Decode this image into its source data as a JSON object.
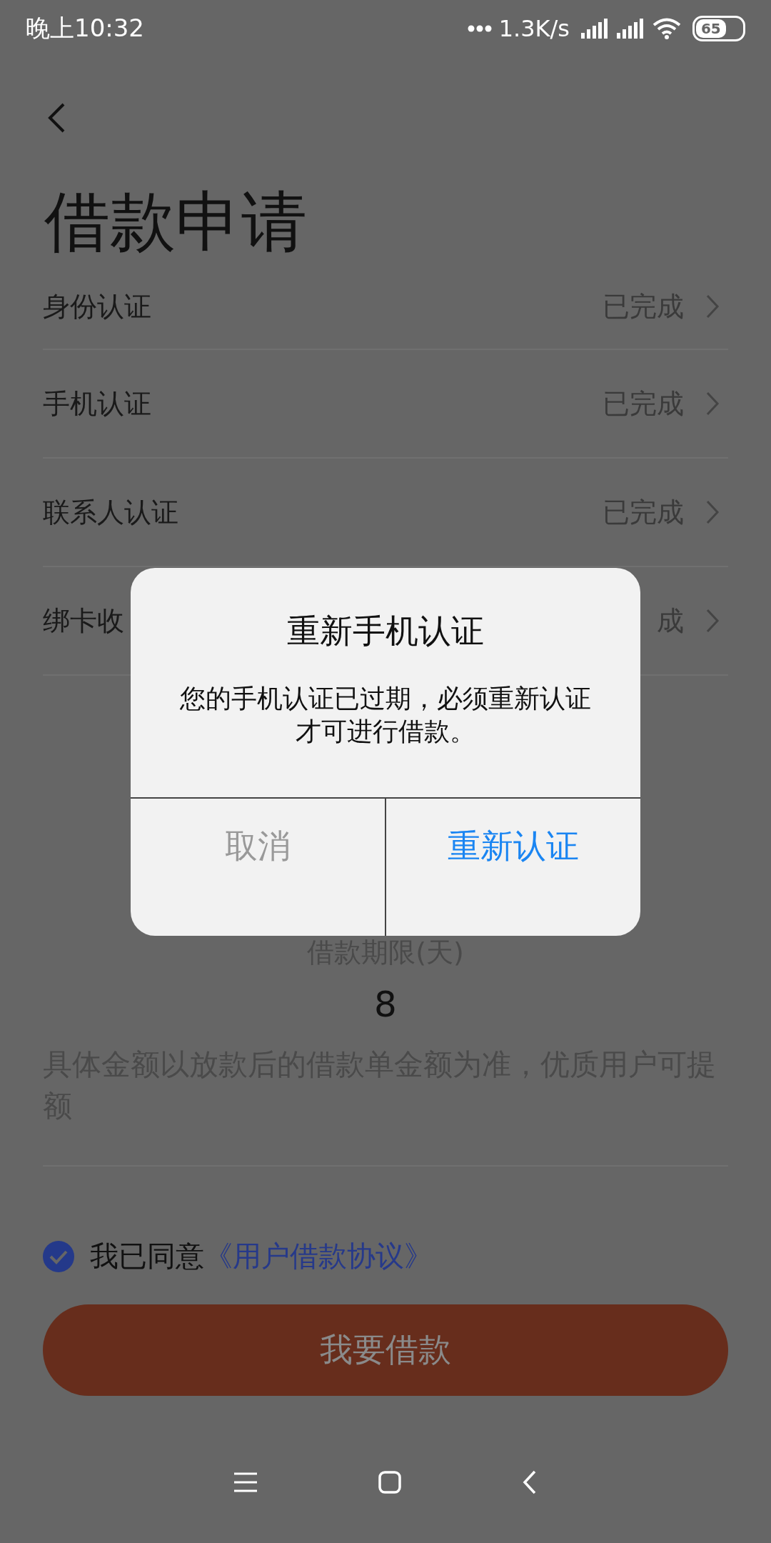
{
  "status_bar": {
    "time": "晚上10:32",
    "net_speed": "1.3K/s",
    "battery": "65"
  },
  "title": "借款申请",
  "steps": [
    {
      "label": "身份认证",
      "status": "已完成"
    },
    {
      "label": "手机认证",
      "status": "已完成"
    },
    {
      "label": "联系人认证",
      "status": "已完成"
    },
    {
      "label": "绑卡收",
      "status": "成"
    }
  ],
  "term": {
    "label": "借款期限(天)",
    "value": "8"
  },
  "note": "具体金额以放款后的借款单金额为准，优质用户可提额",
  "agreement": {
    "checked": true,
    "prefix": "我已同意",
    "link": "《用户借款协议》"
  },
  "submit": "我要借款",
  "dialog": {
    "title": "重新手机认证",
    "message": "您的手机认证已过期，必须重新认证才可进行借款。",
    "buttons": [
      {
        "label": "取消",
        "kind": "cancel"
      },
      {
        "label": "重新认证",
        "kind": "confirm"
      }
    ]
  }
}
